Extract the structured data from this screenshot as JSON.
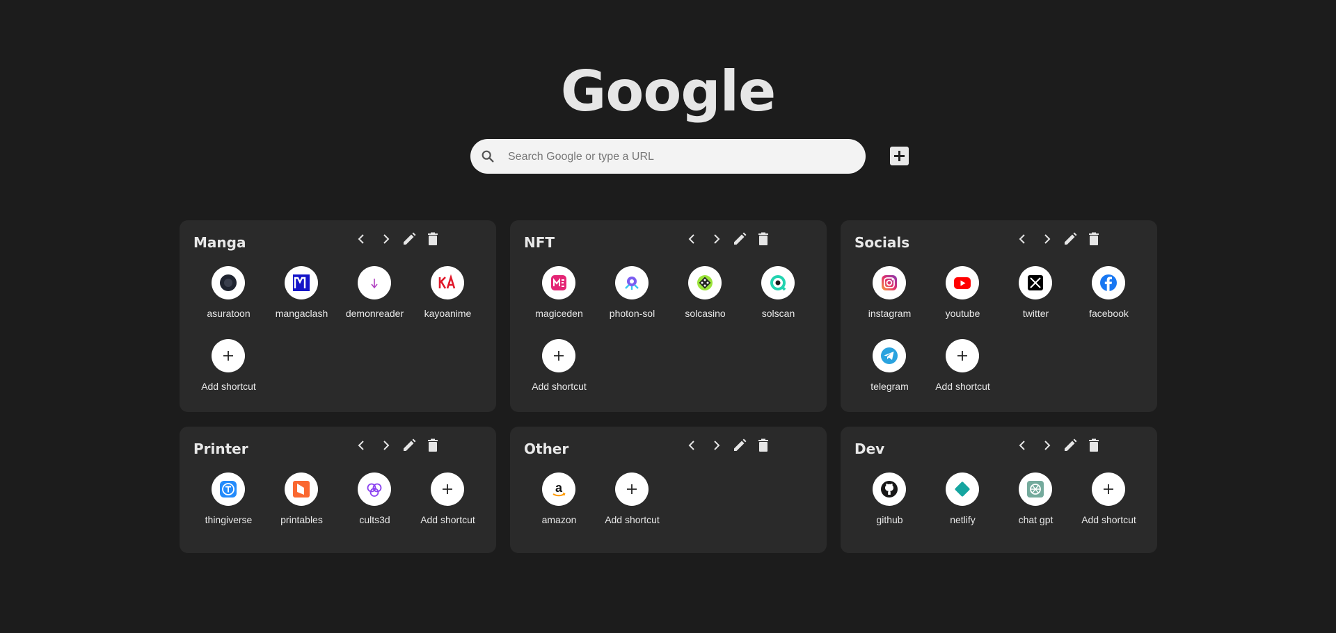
{
  "logo": "Google",
  "search": {
    "placeholder": "Search Google or type a URL"
  },
  "groups": [
    {
      "title": "Manga",
      "shortcuts": [
        {
          "label": "asuratoon",
          "icon": "asuratoon-icon"
        },
        {
          "label": "mangaclash",
          "icon": "mangaclash-icon"
        },
        {
          "label": "demonreader",
          "icon": "demonreader-icon"
        },
        {
          "label": "kayoanime",
          "icon": "kayoanime-icon"
        },
        {
          "label": "Add shortcut",
          "icon": "plus-icon"
        }
      ]
    },
    {
      "title": "NFT",
      "shortcuts": [
        {
          "label": "magiceden",
          "icon": "magiceden-icon"
        },
        {
          "label": "photon-sol",
          "icon": "photon-icon"
        },
        {
          "label": "solcasino",
          "icon": "solcasino-icon"
        },
        {
          "label": "solscan",
          "icon": "solscan-icon"
        },
        {
          "label": "Add shortcut",
          "icon": "plus-icon"
        }
      ]
    },
    {
      "title": "Socials",
      "shortcuts": [
        {
          "label": "instagram",
          "icon": "instagram-icon"
        },
        {
          "label": "youtube",
          "icon": "youtube-icon"
        },
        {
          "label": "twitter",
          "icon": "x-icon"
        },
        {
          "label": "facebook",
          "icon": "facebook-icon"
        },
        {
          "label": "telegram",
          "icon": "telegram-icon"
        },
        {
          "label": "Add shortcut",
          "icon": "plus-icon"
        }
      ]
    },
    {
      "title": "Printer",
      "shortcuts": [
        {
          "label": "thingiverse",
          "icon": "thingiverse-icon"
        },
        {
          "label": "printables",
          "icon": "printables-icon"
        },
        {
          "label": "cults3d",
          "icon": "cults3d-icon"
        },
        {
          "label": "Add shortcut",
          "icon": "plus-icon"
        }
      ]
    },
    {
      "title": "Other",
      "shortcuts": [
        {
          "label": "amazon",
          "icon": "amazon-icon"
        },
        {
          "label": "Add shortcut",
          "icon": "plus-icon"
        }
      ]
    },
    {
      "title": "Dev",
      "shortcuts": [
        {
          "label": "github",
          "icon": "github-icon"
        },
        {
          "label": "netlify",
          "icon": "netlify-icon"
        },
        {
          "label": "chat gpt",
          "icon": "chatgpt-icon"
        },
        {
          "label": "Add shortcut",
          "icon": "plus-icon"
        }
      ]
    }
  ],
  "colors": {
    "background": "#1c1c1c",
    "panel": "#2a2a2a",
    "text": "#e8e8e8"
  }
}
